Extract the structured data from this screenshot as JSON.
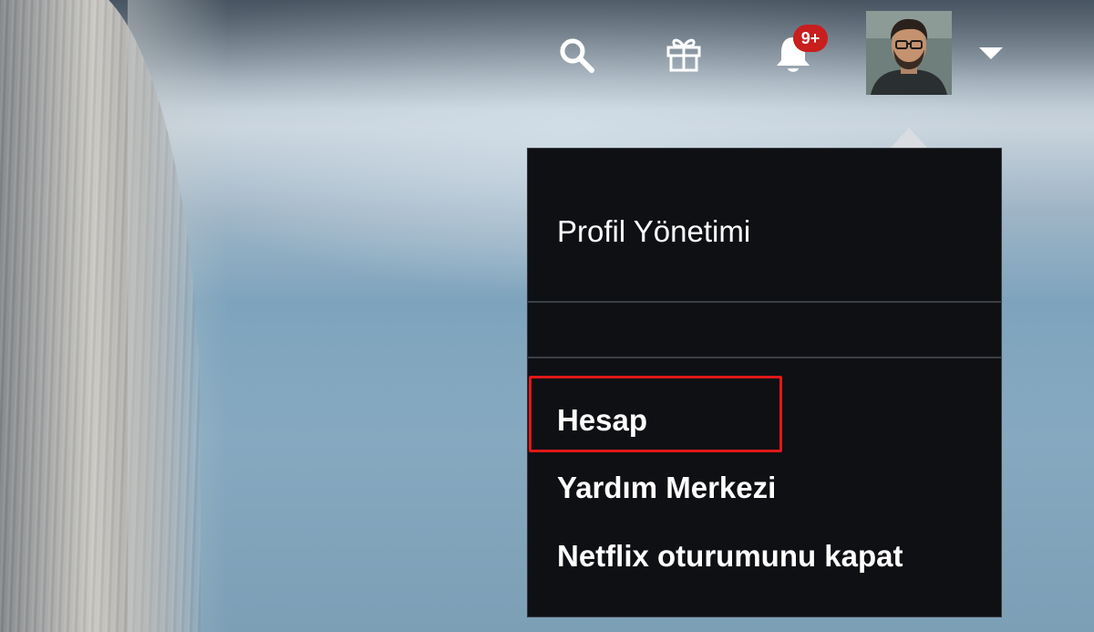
{
  "header": {
    "icons": [
      "search-icon",
      "gift-icon",
      "bell-icon",
      "chevron-down-icon"
    ],
    "notification_badge": "9+",
    "badge_color": "#c81e1e",
    "avatar": "profile-avatar"
  },
  "dropdown": {
    "items": [
      {
        "label": "Profil Yönetimi"
      },
      {
        "label": "Hesap",
        "highlighted": true
      },
      {
        "label": "Yardım Merkezi"
      },
      {
        "label": "Netflix oturumunu kapat"
      }
    ],
    "background_color": "#0f1014",
    "highlight_color": "#e01818"
  }
}
